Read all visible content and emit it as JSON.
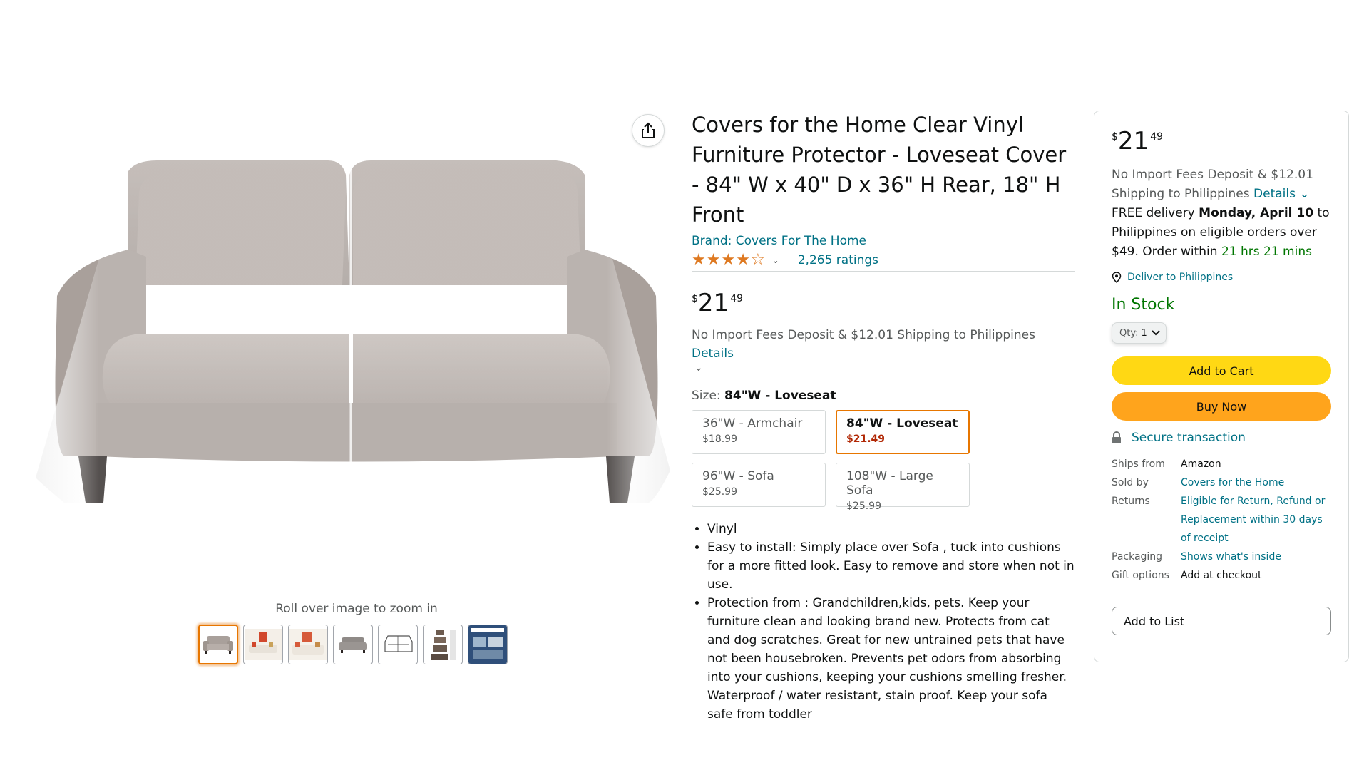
{
  "product": {
    "title": "Covers for the Home Clear Vinyl Furniture Protector - Loveseat Cover - 84\" W x 40\" D x 36\" H Rear, 18\" H Front",
    "brand": "Brand: Covers For The Home",
    "rating": 4.3,
    "ratings_count": "2,265 ratings",
    "price": {
      "currency": "$",
      "whole": "21",
      "fraction": "49"
    },
    "shipping_note": "No Import Fees Deposit & $12.01 Shipping to Philippines",
    "details_link": "Details",
    "size_label": "Size:",
    "size_selected": "84\"W - Loveseat",
    "sizes": [
      {
        "name": "36\"W - Armchair",
        "price": "$18.99"
      },
      {
        "name": "84\"W - Loveseat",
        "price": "$21.49"
      },
      {
        "name": "96\"W - Sofa",
        "price": "$25.99"
      },
      {
        "name": "108\"W - Large Sofa",
        "price": "$25.99"
      }
    ],
    "bullets": [
      "Vinyl",
      "Easy to install: Simply place over Sofa , tuck into cushions for a more fitted look. Easy to remove and store when not in use.",
      "Protection from : Grandchildren,kids, pets. Keep your furniture clean and looking brand new. Protects from cat and dog scratches. Great for new untrained pets that have not been housebroken. Prevents pet odors from absorbing into your cushions, keeping your cushions smelling fresher. Waterproof / water resistant, stain proof. Keep your sofa safe from toddler"
    ]
  },
  "gallery": {
    "zoom_hint": "Roll over image to zoom in",
    "thumbnails": [
      "sofa-grey",
      "sofa-room-orange",
      "sofa-room-pillows",
      "sofa-grey-side",
      "sofa-line-drawing",
      "size-chart",
      "infographic"
    ]
  },
  "buybox": {
    "price": {
      "currency": "$",
      "whole": "21",
      "fraction": "49"
    },
    "ship_line1": "No Import Fees Deposit & $12.01",
    "ship_line2": "Shipping to Philippines",
    "details_link": "Details",
    "free_delivery": "FREE delivery",
    "delivery_date": "Monday, April 10",
    "delivery_tail": "to Philippines on eligible orders over $49. Order within",
    "countdown": "21 hrs 21 mins",
    "deliver_to": "Deliver to Philippines",
    "stock": "In Stock",
    "qty_label": "Qty:",
    "qty_value": "1",
    "add_to_cart": "Add to Cart",
    "buy_now": "Buy Now",
    "secure": "Secure transaction",
    "info": [
      {
        "key": "Ships from",
        "value": "Amazon",
        "link": false
      },
      {
        "key": "Sold by",
        "value": "Covers for the Home",
        "link": true
      },
      {
        "key": "Returns",
        "value": "Eligible for Return, Refund or Replacement within 30 days of receipt",
        "link": true
      },
      {
        "key": "Packaging",
        "value": "Shows what's inside",
        "link": true
      },
      {
        "key": "Gift options",
        "value": "Add at checkout",
        "link": false
      }
    ],
    "add_to_list": "Add to List"
  },
  "colors": {
    "link": "#007185",
    "accent_orange": "#e77600",
    "cart_yellow": "#ffd814",
    "buy_orange": "#ffa41c",
    "in_stock_green": "#007600",
    "price_red": "#b12704"
  }
}
